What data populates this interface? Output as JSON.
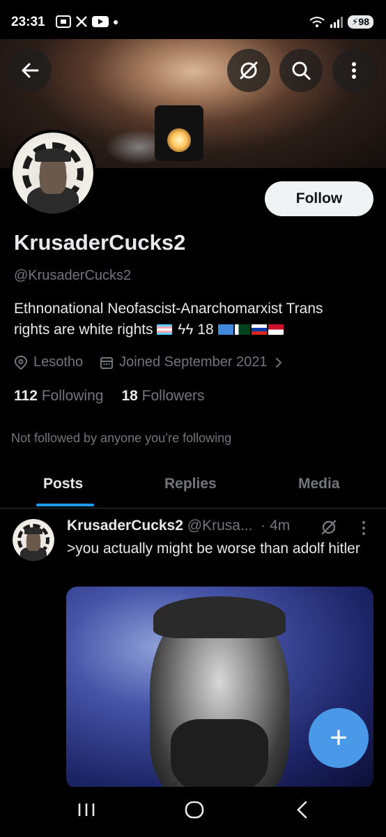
{
  "status_bar": {
    "time": "23:31",
    "battery": "98"
  },
  "colors": {
    "accent": "#1d9bf0",
    "fab": "#4a99e9",
    "muted": "#71767b",
    "text": "#e7e9ea"
  },
  "icons": {
    "back": "arrow-left-icon",
    "grok": "slashed-circle-icon",
    "search": "search-icon",
    "more": "more-vertical-icon"
  },
  "profile": {
    "follow_label": "Follow",
    "display_name": "KrusaderCucks2",
    "handle": "@KrusaderCucks2",
    "bio_line1": "Ethnonational Neofascist-Anarchomarxist Trans",
    "bio_line2": "rights are white rights",
    "bio_symbols": "ϟϟ 18",
    "location": "Lesotho",
    "joined": "Joined September 2021",
    "following_count": "112",
    "following_label": "Following",
    "followers_count": "18",
    "followers_label": "Followers",
    "not_followed": "Not followed by anyone you’re following"
  },
  "tabs": [
    {
      "label": "Posts"
    },
    {
      "label": "Replies"
    },
    {
      "label": "Media"
    }
  ],
  "post": {
    "author": "KrusaderCucks2",
    "handle": "@Krusa...",
    "time": "· 4m",
    "text": ">you actually might be worse than adolf hitler"
  },
  "fab_label": "+"
}
